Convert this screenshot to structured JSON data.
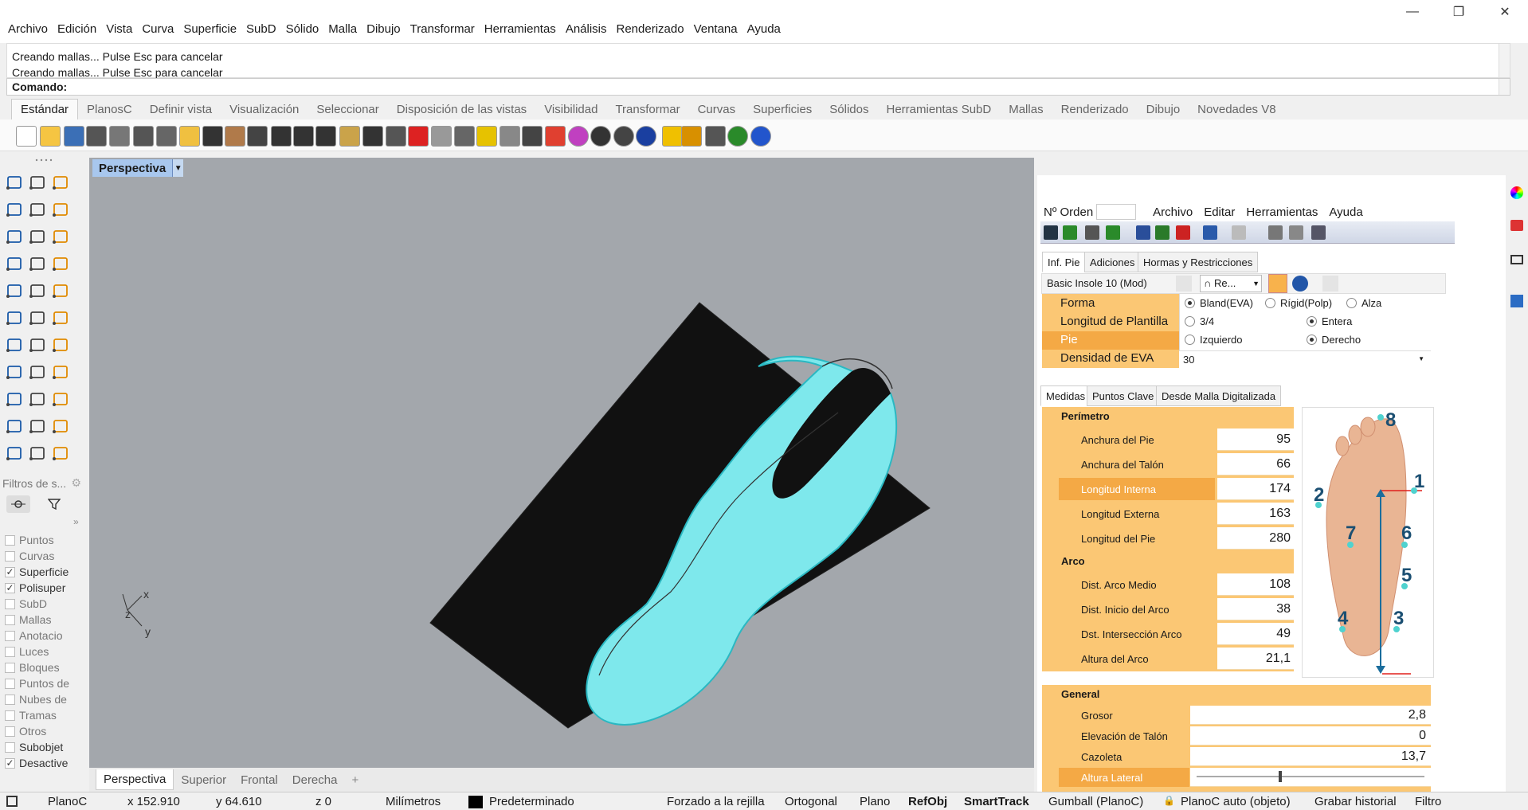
{
  "menubar": {
    "items": [
      "Archivo",
      "Edición",
      "Vista",
      "Curva",
      "Superficie",
      "SubD",
      "Sólido",
      "Malla",
      "Dibujo",
      "Transformar",
      "Herramientas",
      "Análisis",
      "Renderizado",
      "Ventana",
      "Ayuda"
    ],
    "window_controls": {
      "minimize": "—",
      "restore": "❐",
      "close": "✕"
    }
  },
  "history": {
    "lines": [
      "Creando mallas... Pulse Esc para cancelar",
      "Creando mallas... Pulse Esc para cancelar"
    ]
  },
  "command": {
    "label": "Comando:"
  },
  "toolbar_tabs": [
    "Estándar",
    "PlanosC",
    "Definir vista",
    "Visualización",
    "Seleccionar",
    "Disposición de las vistas",
    "Visibilidad",
    "Transformar",
    "Curvas",
    "Superficies",
    "Sólidos",
    "Herramientas SubD",
    "Mallas",
    "Renderizado",
    "Dibujo",
    "Novedades V8"
  ],
  "toolbar_icons": [
    "new-file-icon",
    "open-folder-icon",
    "save-icon",
    "print-icon",
    "import-icon",
    "cut-icon",
    "copy-icon",
    "paste-icon",
    "undo-icon",
    "pan-hand-icon",
    "rotate-view-icon",
    "zoom-icon",
    "zoom-window-icon",
    "zoom-extents-icon",
    "zoom-selected-icon",
    "rotate-camera-icon",
    "four-viewports-icon",
    "car-render-icon",
    "grid-plane-icon",
    "osnap-icon",
    "points-icon",
    "light-bulb-icon",
    "lock-icon",
    "layer-icon",
    "color-wheel-icon",
    "shaded-sphere-icon",
    "wire-sphere-icon",
    "render-sphere-icon",
    "pointer-flag-icon",
    "gear-options-icon",
    "tools-icon",
    "globe-icon",
    "help-icon"
  ],
  "left_panel": {
    "filter_label": "Filtros de s...",
    "layers": [
      {
        "name": "Puntos",
        "checked": false
      },
      {
        "name": "Curvas",
        "checked": false
      },
      {
        "name": "Superficie",
        "checked": true
      },
      {
        "name": "Polisuper",
        "checked": true
      },
      {
        "name": "SubD",
        "checked": false
      },
      {
        "name": "Mallas",
        "checked": false
      },
      {
        "name": "Anotacio",
        "checked": false
      },
      {
        "name": "Luces",
        "checked": false
      },
      {
        "name": "Bloques",
        "checked": false
      },
      {
        "name": "Puntos de",
        "checked": false
      },
      {
        "name": "Nubes de",
        "checked": false
      },
      {
        "name": "Tramas",
        "checked": false
      },
      {
        "name": "Otros",
        "checked": false
      },
      {
        "name": "Subobjet",
        "checked": false
      },
      {
        "name": "Desactive",
        "checked": true
      }
    ]
  },
  "viewport": {
    "title": "Perspectiva",
    "axes": {
      "x": "x",
      "y": "y",
      "z": "z"
    },
    "tabs": [
      "Perspectiva",
      "Superior",
      "Frontal",
      "Derecha"
    ],
    "add_tab": "+",
    "colors": {
      "background": "#a3a7ac",
      "insole": "#7ee8ec",
      "block": "#111111"
    }
  },
  "statusbar": {
    "cplane": "PlanoC",
    "x": "x 152.910",
    "y": "y 64.610",
    "z": "z 0",
    "units": "Milímetros",
    "layer": "Predeterminado",
    "items": [
      "Forzado a la rejilla",
      "Ortogonal",
      "Plano",
      "RefObj",
      "SmartTrack",
      "Gumball (PlanoC)",
      "PlanoC auto (objeto)",
      "Grabar historial",
      "Filtro"
    ],
    "bold_items": [
      "RefObj",
      "SmartTrack"
    ]
  },
  "plugin": {
    "order_label": "Nº Orden",
    "order_value": "",
    "menu": [
      "Archivo",
      "Editar",
      "Herramientas",
      "Ayuda"
    ],
    "tabs_top": [
      "Inf. Pie",
      "Adiciones",
      "Hormas y Restricciones"
    ],
    "model": "Basic Insole 10 (Mod)",
    "model_option": "Re...",
    "forma": {
      "label": "Forma",
      "options": [
        "Bland(EVA)",
        "Rígid(Polp)",
        "Alza"
      ],
      "selected": 0
    },
    "longitud": {
      "label": "Longitud de Plantilla",
      "options": [
        "3/4",
        "Entera"
      ],
      "selected": 1
    },
    "pie": {
      "label": "Pie",
      "options": [
        "Izquierdo",
        "Derecho"
      ],
      "selected": 1
    },
    "densidad": {
      "label": "Densidad de EVA",
      "value": "30"
    },
    "tabs_mid": [
      "Medidas",
      "Puntos Clave",
      "Desde Malla Digitalizada"
    ],
    "perimetro": {
      "title": "Perímetro",
      "rows": [
        {
          "label": "Anchura del Pie",
          "value": "95"
        },
        {
          "label": "Anchura del Talón",
          "value": "66"
        },
        {
          "label": "Longitud Interna",
          "value": "174"
        },
        {
          "label": "Longitud Externa",
          "value": "163"
        },
        {
          "label": "Longitud del Pie",
          "value": "280"
        }
      ]
    },
    "arco": {
      "title": "Arco",
      "rows": [
        {
          "label": "Dist. Arco Medio",
          "value": "108"
        },
        {
          "label": "Dist. Inicio del Arco",
          "value": "38"
        },
        {
          "label": "Dst. Intersección Arco",
          "value": "49"
        },
        {
          "label": "Altura del Arco",
          "value": "21,1"
        }
      ]
    },
    "foot_points": [
      "8",
      "1",
      "2",
      "7",
      "6",
      "5",
      "4",
      "3"
    ],
    "general": {
      "title": "General",
      "rows": [
        {
          "label": "Grosor",
          "value": "2,8"
        },
        {
          "label": "Elevación de Talón",
          "value": "0"
        },
        {
          "label": "Cazoleta",
          "value": "13,7"
        },
        {
          "label": "Altura Lateral",
          "value": ""
        }
      ],
      "slider_level": 0.36
    }
  }
}
